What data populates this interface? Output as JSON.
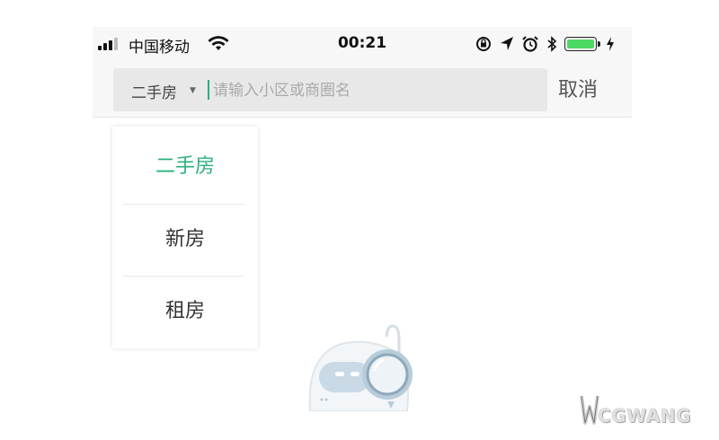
{
  "status_bar": {
    "carrier": "中国移动",
    "time": "00:21",
    "icons": [
      "signal-icon",
      "wifi-icon",
      "rotation-lock-icon",
      "location-arrow-icon",
      "alarm-icon",
      "bluetooth-icon",
      "battery-icon",
      "charging-icon"
    ],
    "battery_color": "#4cd964"
  },
  "search": {
    "type_label": "二手房",
    "placeholder": "请输入小区或商圈名",
    "value": "",
    "cancel_label": "取消"
  },
  "dropdown": {
    "items": [
      {
        "label": "二手房",
        "selected": true
      },
      {
        "label": "新房",
        "selected": false
      },
      {
        "label": "租房",
        "selected": false
      }
    ]
  },
  "accent_color": "#2bb07a",
  "watermark": {
    "text": "CGWANG"
  }
}
